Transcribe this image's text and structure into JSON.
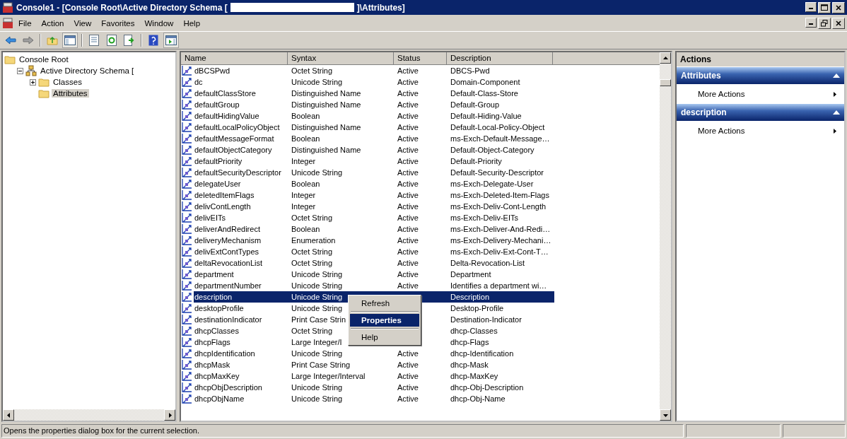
{
  "window": {
    "title_parts": [
      "Console1 - [Console Root\\Active Directory Schema [",
      "]\\Attributes]"
    ]
  },
  "menu": [
    "File",
    "Action",
    "View",
    "Favorites",
    "Window",
    "Help"
  ],
  "tree": [
    {
      "label": "Console Root",
      "selected": false,
      "children": [
        {
          "label": "Active Directory Schema [",
          "expanded": true,
          "selected": false,
          "children": [
            {
              "label": "Classes",
              "expanded": false,
              "selected": false
            },
            {
              "label": "Attributes",
              "selected": true
            }
          ]
        }
      ]
    }
  ],
  "table": {
    "columns": [
      "Name",
      "Syntax",
      "Status",
      "Description"
    ],
    "rows": [
      {
        "name": "dBCSPwd",
        "syntax": "Octet String",
        "status": "Active",
        "description": "DBCS-Pwd",
        "selected": false
      },
      {
        "name": "dc",
        "syntax": "Unicode String",
        "status": "Active",
        "description": "Domain-Component",
        "selected": false
      },
      {
        "name": "defaultClassStore",
        "syntax": "Distinguished Name",
        "status": "Active",
        "description": "Default-Class-Store",
        "selected": false
      },
      {
        "name": "defaultGroup",
        "syntax": "Distinguished Name",
        "status": "Active",
        "description": "Default-Group",
        "selected": false
      },
      {
        "name": "defaultHidingValue",
        "syntax": "Boolean",
        "status": "Active",
        "description": "Default-Hiding-Value",
        "selected": false
      },
      {
        "name": "defaultLocalPolicyObject",
        "syntax": "Distinguished Name",
        "status": "Active",
        "description": "Default-Local-Policy-Object",
        "selected": false
      },
      {
        "name": "defaultMessageFormat",
        "syntax": "Boolean",
        "status": "Active",
        "description": "ms-Exch-Default-Message…",
        "selected": false
      },
      {
        "name": "defaultObjectCategory",
        "syntax": "Distinguished Name",
        "status": "Active",
        "description": "Default-Object-Category",
        "selected": false
      },
      {
        "name": "defaultPriority",
        "syntax": "Integer",
        "status": "Active",
        "description": "Default-Priority",
        "selected": false
      },
      {
        "name": "defaultSecurityDescriptor",
        "syntax": "Unicode String",
        "status": "Active",
        "description": "Default-Security-Descriptor",
        "selected": false
      },
      {
        "name": "delegateUser",
        "syntax": "Boolean",
        "status": "Active",
        "description": "ms-Exch-Delegate-User",
        "selected": false
      },
      {
        "name": "deletedItemFlags",
        "syntax": "Integer",
        "status": "Active",
        "description": "ms-Exch-Deleted-Item-Flags",
        "selected": false
      },
      {
        "name": "delivContLength",
        "syntax": "Integer",
        "status": "Active",
        "description": "ms-Exch-Deliv-Cont-Length",
        "selected": false
      },
      {
        "name": "delivEITs",
        "syntax": "Octet String",
        "status": "Active",
        "description": "ms-Exch-Deliv-EITs",
        "selected": false
      },
      {
        "name": "deliverAndRedirect",
        "syntax": "Boolean",
        "status": "Active",
        "description": "ms-Exch-Deliver-And-Redi…",
        "selected": false
      },
      {
        "name": "deliveryMechanism",
        "syntax": "Enumeration",
        "status": "Active",
        "description": "ms-Exch-Delivery-Mechani…",
        "selected": false
      },
      {
        "name": "delivExtContTypes",
        "syntax": "Octet String",
        "status": "Active",
        "description": "ms-Exch-Deliv-Ext-Cont-T…",
        "selected": false
      },
      {
        "name": "deltaRevocationList",
        "syntax": "Octet String",
        "status": "Active",
        "description": "Delta-Revocation-List",
        "selected": false
      },
      {
        "name": "department",
        "syntax": "Unicode String",
        "status": "Active",
        "description": "Department",
        "selected": false
      },
      {
        "name": "departmentNumber",
        "syntax": "Unicode String",
        "status": "Active",
        "description": "Identifies a department wi…",
        "selected": false
      },
      {
        "name": "description",
        "syntax": "Unicode String",
        "description": "Description",
        "selected": true
      },
      {
        "name": "desktopProfile",
        "syntax": "Unicode String",
        "description": "Desktop-Profile",
        "selected": false
      },
      {
        "name": "destinationIndicator",
        "syntax": "Print Case Strin",
        "description": "Destination-Indicator",
        "selected": false
      },
      {
        "name": "dhcpClasses",
        "syntax": "Octet String",
        "description": "dhcp-Classes",
        "selected": false
      },
      {
        "name": "dhcpFlags",
        "syntax": "Large Integer/I",
        "description": "dhcp-Flags",
        "selected": false
      },
      {
        "name": "dhcpIdentification",
        "syntax": "Unicode String",
        "status": "Active",
        "description": "dhcp-Identification",
        "selected": false
      },
      {
        "name": "dhcpMask",
        "syntax": "Print Case String",
        "status": "Active",
        "description": "dhcp-Mask",
        "selected": false
      },
      {
        "name": "dhcpMaxKey",
        "syntax": "Large Integer/Interval",
        "status": "Active",
        "description": "dhcp-MaxKey",
        "selected": false
      },
      {
        "name": "dhcpObjDescription",
        "syntax": "Unicode String",
        "status": "Active",
        "description": "dhcp-Obj-Description",
        "selected": false
      },
      {
        "name": "dhcpObjName",
        "syntax": "Unicode String",
        "status": "Active",
        "description": "dhcp-Obj-Name",
        "selected": false
      }
    ]
  },
  "context_menu": [
    {
      "kind": "item",
      "label": "Refresh",
      "selected": false
    },
    {
      "kind": "separator"
    },
    {
      "kind": "item",
      "label": "Properties",
      "selected": true
    },
    {
      "kind": "separator"
    },
    {
      "kind": "item",
      "label": "Help",
      "selected": false
    }
  ],
  "actions": {
    "title": "Actions",
    "sections": [
      {
        "title": "Attributes",
        "items": [
          "More Actions"
        ]
      },
      {
        "title": "description",
        "items": [
          "More Actions"
        ]
      }
    ]
  },
  "status_bar": {
    "text": "Opens the properties dialog box for the current selection."
  }
}
